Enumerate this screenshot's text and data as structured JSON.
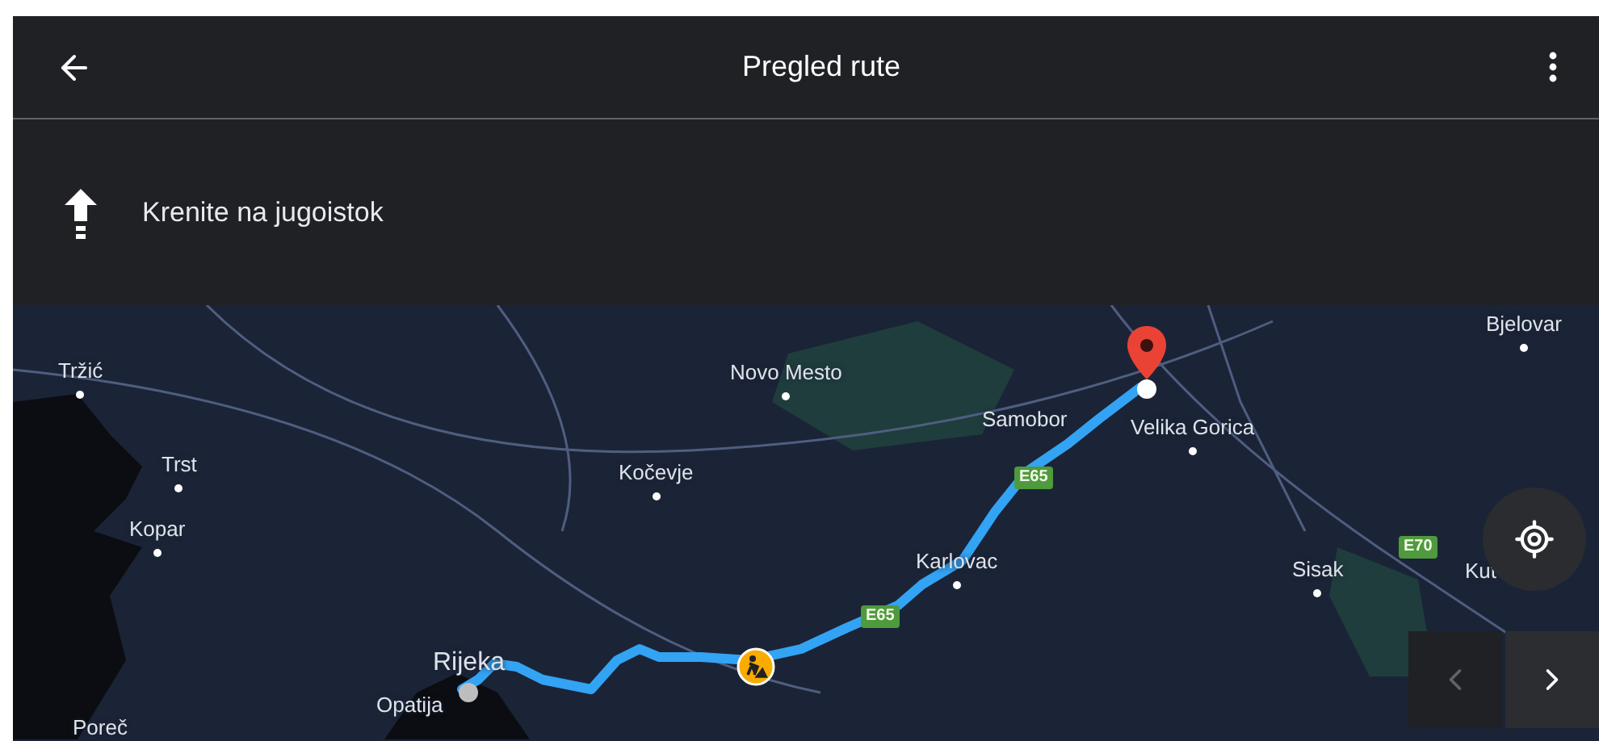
{
  "header": {
    "title": "Pregled rute"
  },
  "instruction": {
    "text": "Krenite na jugoistok"
  },
  "map": {
    "labels": [
      {
        "kind": "town",
        "text": "Bjelovar"
      },
      {
        "kind": "town",
        "text": "Tržić"
      },
      {
        "kind": "town",
        "text": "Novo Mesto"
      },
      {
        "kind": "place",
        "text": "Samobor"
      },
      {
        "kind": "town",
        "text": "Velika Gorica"
      },
      {
        "kind": "town",
        "text": "Trst"
      },
      {
        "kind": "town",
        "text": "Kočevje"
      },
      {
        "kind": "town",
        "text": "Kopar"
      },
      {
        "kind": "town",
        "text": "Karlovac"
      },
      {
        "kind": "town",
        "text": "Sisak"
      },
      {
        "kind": "place",
        "text": "Kut"
      },
      {
        "kind": "city",
        "text": "Rijeka"
      },
      {
        "kind": "place",
        "text": "Opatija"
      },
      {
        "kind": "place",
        "text": "Poreč"
      },
      {
        "kind": "shield",
        "text": "E65"
      },
      {
        "kind": "shield",
        "text": "E65"
      },
      {
        "kind": "shield",
        "text": "E70"
      }
    ]
  },
  "nav_buttons": [
    {
      "kind": "previous",
      "disabled": true
    },
    {
      "kind": "next",
      "disabled": false
    }
  ]
}
